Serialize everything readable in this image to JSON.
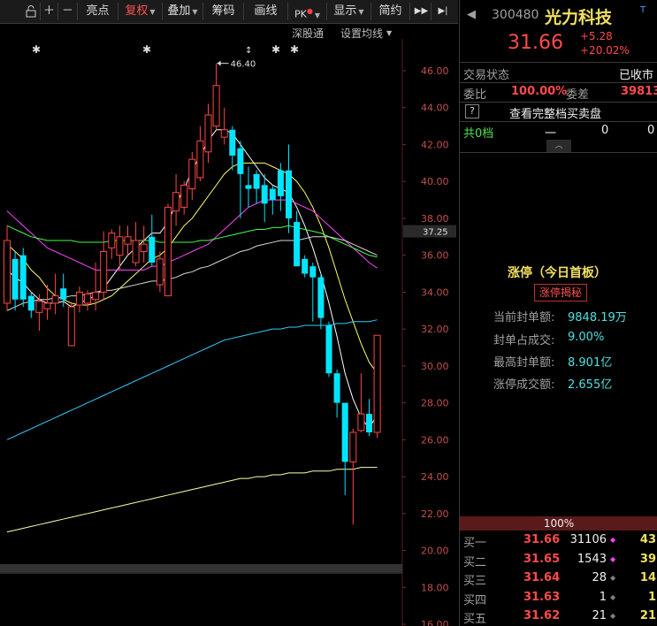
{
  "toolbar": {
    "buttons": [
      {
        "label": "亮点",
        "dropdown": false
      },
      {
        "label": "复权",
        "dropdown": true,
        "active": true
      },
      {
        "label": "叠加",
        "dropdown": true
      },
      {
        "label": "筹码",
        "dropdown": false
      },
      {
        "label": "画线",
        "dropdown": false
      },
      {
        "label": "PK",
        "dropdown": true
      },
      {
        "label": "显示",
        "dropdown": true
      },
      {
        "label": "简约",
        "dropdown": false
      }
    ],
    "sub": {
      "shenguton": "深股通",
      "ma_settings": "设置均线"
    }
  },
  "chart_data": {
    "type": "candlestick",
    "y_ticks": [
      "46.00",
      "44.00",
      "42.00",
      "40.00",
      "38.00",
      "36.00",
      "34.00",
      "32.00",
      "30.00",
      "28.00",
      "26.00",
      "24.00",
      "22.00",
      "20.00",
      "18.00",
      "16.00"
    ],
    "ylim": [
      16,
      46
    ],
    "high_marker": "46.40",
    "current_price_label": "37.25",
    "candles": [
      {
        "o": 33.4,
        "c": 36.8,
        "h": 37.6,
        "l": 33.0
      },
      {
        "o": 35.8,
        "c": 33.6,
        "h": 36.2,
        "l": 33.0
      },
      {
        "o": 36.0,
        "c": 33.6,
        "h": 36.4,
        "l": 33.2
      },
      {
        "o": 33.8,
        "c": 33.0,
        "h": 34.0,
        "l": 32.6
      },
      {
        "o": 32.9,
        "c": 33.5,
        "h": 33.9,
        "l": 31.9
      },
      {
        "o": 33.1,
        "c": 33.4,
        "h": 34.4,
        "l": 32.5
      },
      {
        "o": 33.4,
        "c": 33.8,
        "h": 35.0,
        "l": 32.8
      },
      {
        "o": 34.2,
        "c": 33.6,
        "h": 35.0,
        "l": 33.2
      },
      {
        "o": 31.1,
        "c": 33.2,
        "h": 33.4,
        "l": 31.1
      },
      {
        "o": 33.3,
        "c": 34.0,
        "h": 34.3,
        "l": 32.9
      },
      {
        "o": 33.4,
        "c": 33.9,
        "h": 34.1,
        "l": 33.0
      },
      {
        "o": 33.6,
        "c": 34.0,
        "h": 35.6,
        "l": 33.0
      },
      {
        "o": 34.0,
        "c": 36.2,
        "h": 37.3,
        "l": 33.6
      },
      {
        "o": 36.4,
        "c": 37.2,
        "h": 37.4,
        "l": 35.8
      },
      {
        "o": 36.0,
        "c": 37.0,
        "h": 37.6,
        "l": 35.2
      },
      {
        "o": 36.6,
        "c": 37.0,
        "h": 37.6,
        "l": 36.0
      },
      {
        "o": 35.6,
        "c": 36.8,
        "h": 37.8,
        "l": 35.4
      },
      {
        "o": 36.2,
        "c": 36.6,
        "h": 37.6,
        "l": 35.6
      },
      {
        "o": 37.0,
        "c": 35.6,
        "h": 38.2,
        "l": 35.4
      },
      {
        "o": 34.4,
        "c": 35.8,
        "h": 36.2,
        "l": 34.0
      },
      {
        "o": 33.8,
        "c": 38.6,
        "h": 38.8,
        "l": 33.8
      },
      {
        "o": 38.4,
        "c": 39.4,
        "h": 40.4,
        "l": 37.6
      },
      {
        "o": 38.6,
        "c": 39.8,
        "h": 40.0,
        "l": 38.2
      },
      {
        "o": 39.6,
        "c": 41.2,
        "h": 41.6,
        "l": 39.0
      },
      {
        "o": 40.2,
        "c": 42.2,
        "h": 43.0,
        "l": 40.0
      },
      {
        "o": 41.6,
        "c": 43.6,
        "h": 44.2,
        "l": 41.0
      },
      {
        "o": 43.0,
        "c": 45.2,
        "h": 46.4,
        "l": 42.8
      },
      {
        "o": 42.4,
        "c": 42.8,
        "h": 44.0,
        "l": 42.0
      },
      {
        "o": 42.8,
        "c": 41.4,
        "h": 43.0,
        "l": 40.6
      },
      {
        "o": 41.8,
        "c": 40.4,
        "h": 42.2,
        "l": 38.0
      },
      {
        "o": 39.8,
        "c": 39.6,
        "h": 40.8,
        "l": 38.6
      },
      {
        "o": 40.4,
        "c": 39.6,
        "h": 40.6,
        "l": 38.8
      },
      {
        "o": 39.8,
        "c": 38.8,
        "h": 40.4,
        "l": 37.8
      },
      {
        "o": 39.6,
        "c": 39.0,
        "h": 39.8,
        "l": 38.2
      },
      {
        "o": 40.6,
        "c": 39.2,
        "h": 41.0,
        "l": 38.4
      },
      {
        "o": 40.6,
        "c": 38.0,
        "h": 42.0,
        "l": 37.2
      },
      {
        "o": 37.8,
        "c": 35.4,
        "h": 38.4,
        "l": 35.4
      },
      {
        "o": 35.8,
        "c": 35.0,
        "h": 36.0,
        "l": 34.8
      },
      {
        "o": 35.4,
        "c": 34.8,
        "h": 35.6,
        "l": 32.4
      },
      {
        "o": 34.8,
        "c": 32.6,
        "h": 35.0,
        "l": 32.0
      },
      {
        "o": 32.2,
        "c": 29.6,
        "h": 32.4,
        "l": 29.4
      },
      {
        "o": 29.6,
        "c": 28.0,
        "h": 29.8,
        "l": 27.2
      },
      {
        "o": 28.0,
        "c": 24.8,
        "h": 28.0,
        "l": 23.0
      },
      {
        "o": 24.8,
        "c": 26.4,
        "h": 26.6,
        "l": 21.4
      },
      {
        "o": 26.5,
        "c": 27.4,
        "h": 29.6,
        "l": 26.4
      },
      {
        "o": 27.4,
        "c": 26.4,
        "h": 28.2,
        "l": 26.2
      },
      {
        "o": 26.4,
        "c": 31.66,
        "h": 31.66,
        "l": 26.1
      }
    ],
    "ma_lines": [
      {
        "color": "#ffffff",
        "values": [
          35.2,
          34.8,
          34.5,
          34.0,
          33.6,
          33.4,
          33.4,
          33.5,
          33.2,
          33.4,
          33.6,
          33.8,
          34.2,
          34.8,
          35.4,
          36.0,
          36.4,
          36.8,
          37.2,
          37.2,
          37.8,
          38.8,
          39.6,
          40.6,
          41.4,
          42.2,
          42.8,
          42.8,
          42.6,
          42.0,
          41.4,
          40.8,
          40.2,
          39.8,
          39.6,
          39.4,
          38.6,
          37.6,
          36.4,
          35.0,
          33.4,
          31.6,
          29.6,
          28.2,
          27.2,
          26.6,
          27.4
        ]
      },
      {
        "color": "#ffff66",
        "values": [
          36.6,
          36.2,
          35.8,
          35.2,
          34.8,
          34.2,
          33.8,
          33.6,
          33.4,
          33.3,
          33.3,
          33.4,
          33.6,
          33.8,
          34.2,
          34.6,
          35.0,
          35.4,
          35.8,
          36.0,
          36.4,
          37.0,
          37.6,
          38.0,
          38.6,
          39.2,
          39.8,
          40.4,
          40.8,
          41.0,
          41.0,
          41.0,
          41.0,
          40.8,
          40.6,
          40.4,
          40.0,
          39.4,
          38.6,
          37.6,
          36.4,
          35.0,
          33.6,
          32.4,
          31.2,
          30.2,
          29.6
        ]
      },
      {
        "color": "#ff44ff",
        "values": [
          38.4,
          38.0,
          37.6,
          37.2,
          36.8,
          36.4,
          36.2,
          36.0,
          35.8,
          35.6,
          35.4,
          35.2,
          35.2,
          35.2,
          35.2,
          35.2,
          35.2,
          35.2,
          35.4,
          35.4,
          35.6,
          35.8,
          36.0,
          36.2,
          36.4,
          36.6,
          37.0,
          37.4,
          37.8,
          38.2,
          38.6,
          38.8,
          39.0,
          39.0,
          39.0,
          39.0,
          38.8,
          38.6,
          38.4,
          38.0,
          37.6,
          37.2,
          36.8,
          36.4,
          36.0,
          35.6,
          35.3
        ]
      },
      {
        "color": "#44ff44",
        "values": [
          37.6,
          37.4,
          37.2,
          37.0,
          36.9,
          36.8,
          36.8,
          36.8,
          36.8,
          36.7,
          36.7,
          36.7,
          36.7,
          36.8,
          36.8,
          36.8,
          36.8,
          36.8,
          36.8,
          36.7,
          36.7,
          36.7,
          36.7,
          36.7,
          36.8,
          36.8,
          36.9,
          37.0,
          37.1,
          37.2,
          37.3,
          37.4,
          37.4,
          37.5,
          37.5,
          37.6,
          37.5,
          37.4,
          37.3,
          37.2,
          37.0,
          36.8,
          36.6,
          36.4,
          36.2,
          36.0,
          35.9
        ]
      },
      {
        "color": "#d8d8d8",
        "values": [
          33.0,
          33.2,
          33.4,
          33.5,
          33.6,
          33.6,
          33.7,
          33.7,
          33.8,
          33.8,
          33.9,
          34.0,
          34.1,
          34.1,
          34.2,
          34.3,
          34.4,
          34.5,
          34.6,
          34.6,
          34.7,
          34.8,
          35.0,
          35.1,
          35.3,
          35.4,
          35.6,
          35.8,
          36.0,
          36.2,
          36.3,
          36.5,
          36.6,
          36.7,
          36.8,
          36.8,
          36.8,
          36.9,
          37.0,
          37.0,
          37.0,
          36.9,
          36.8,
          36.6,
          36.4,
          36.2,
          36.0
        ]
      },
      {
        "color": "#33ccff",
        "values": [
          26.0,
          26.2,
          26.4,
          26.6,
          26.8,
          27.0,
          27.2,
          27.4,
          27.6,
          27.8,
          28.0,
          28.2,
          28.4,
          28.6,
          28.8,
          29.0,
          29.2,
          29.4,
          29.6,
          29.8,
          30.0,
          30.2,
          30.4,
          30.6,
          30.8,
          31.0,
          31.2,
          31.4,
          31.5,
          31.6,
          31.7,
          31.8,
          31.9,
          32.0,
          32.0,
          32.1,
          32.1,
          32.2,
          32.2,
          32.2,
          32.2,
          32.3,
          32.3,
          32.4,
          32.4,
          32.4,
          32.5
        ]
      },
      {
        "color": "#ffffaa",
        "values": [
          21.0,
          21.1,
          21.2,
          21.3,
          21.4,
          21.5,
          21.6,
          21.7,
          21.8,
          21.9,
          22.0,
          22.1,
          22.2,
          22.3,
          22.4,
          22.5,
          22.6,
          22.7,
          22.8,
          22.9,
          23.0,
          23.1,
          23.2,
          23.3,
          23.4,
          23.5,
          23.6,
          23.7,
          23.8,
          23.9,
          23.9,
          24.0,
          24.0,
          24.1,
          24.1,
          24.2,
          24.2,
          24.2,
          24.3,
          24.3,
          24.3,
          24.4,
          24.4,
          24.4,
          24.5,
          24.5,
          24.5
        ]
      }
    ]
  },
  "panel": {
    "code": "300480",
    "name": "光力科技",
    "badge": "T",
    "price": "31.66",
    "change": "+5.28",
    "change_pct": "+20.02%",
    "status_label": "交易状态",
    "status_value": "已收市",
    "weibi_label": "委比",
    "weibi_value": "100.00%",
    "weicha_label": "委差",
    "weicha_value": "39813",
    "help_btn": "?",
    "full_book": "查看完整档买卖盘",
    "sell_levels_label": "共0档",
    "sell_dash": "一",
    "sell_val1": "0",
    "sell_val2": "0",
    "limit_title": "涨停（今日首板）",
    "limit_secret": "涨停揭秘",
    "stats": [
      {
        "label": "当前封单额:",
        "value": "9848.19万"
      },
      {
        "label": "封单占成交:",
        "value": "9.00%"
      },
      {
        "label": "最高封单额:",
        "value": "8.901亿"
      },
      {
        "label": "涨停成交额:",
        "value": "2.655亿"
      }
    ],
    "bar_pct": "100%",
    "bids": [
      {
        "label": "买一",
        "price": "31.66",
        "vol": "31106",
        "chg": "43"
      },
      {
        "label": "买二",
        "price": "31.65",
        "vol": "1543",
        "chg": "39"
      },
      {
        "label": "买三",
        "price": "31.64",
        "vol": "28",
        "chg": "14"
      },
      {
        "label": "买四",
        "price": "31.63",
        "vol": "1",
        "chg": "1"
      },
      {
        "label": "买五",
        "price": "31.62",
        "vol": "21",
        "chg": "21"
      }
    ]
  }
}
